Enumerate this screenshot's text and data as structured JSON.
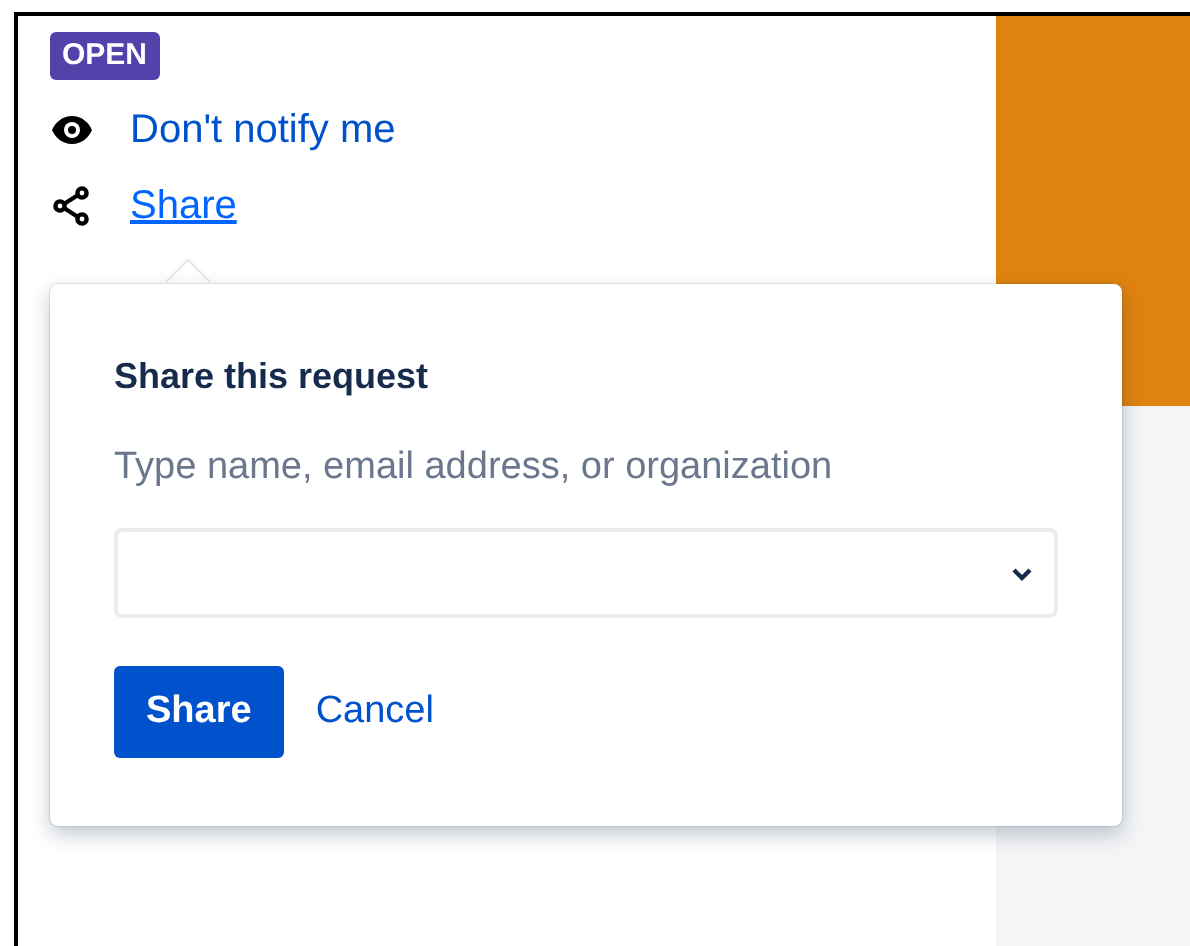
{
  "status": {
    "label": "OPEN"
  },
  "actions": [
    {
      "kind": "watch",
      "label": "Don't notify me",
      "selected": false
    },
    {
      "kind": "share",
      "label": "Share",
      "selected": true
    }
  ],
  "share_popover": {
    "title": "Share this request",
    "field_label": "Type name, email address, or organization",
    "buttons": [
      {
        "kind": "primary",
        "label": "Share"
      },
      {
        "kind": "link",
        "label": "Cancel"
      }
    ]
  }
}
